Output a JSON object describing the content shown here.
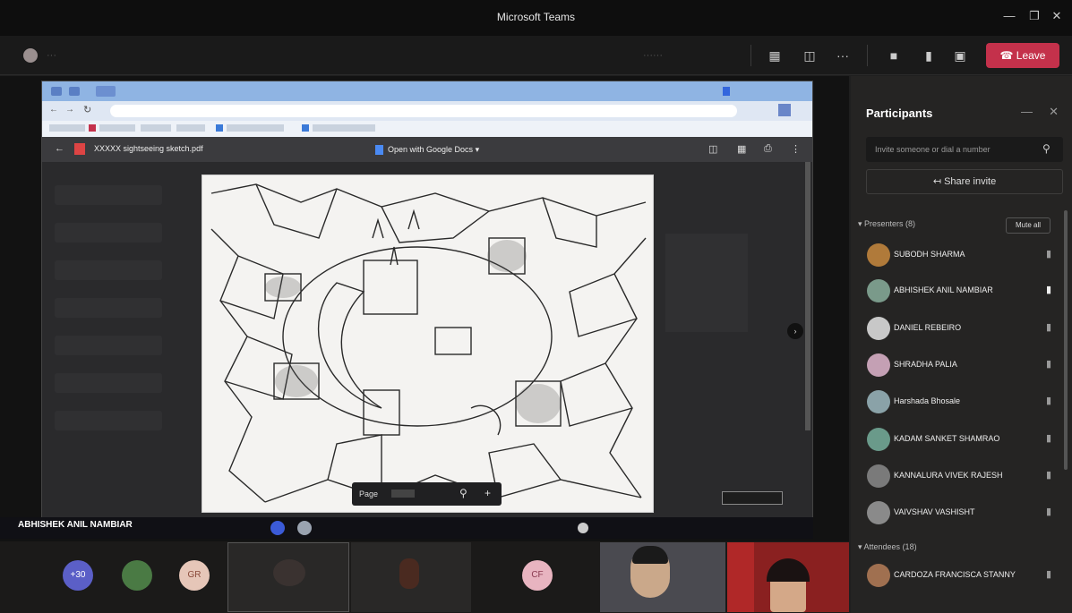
{
  "window": {
    "title": "Microsoft Teams"
  },
  "toolbar": {
    "leave_label": "Leave"
  },
  "browser": {
    "pdf_title": "XXXXX sightseeing sketch.pdf",
    "open_with": "Open with Google Docs",
    "page_label": "Page"
  },
  "taskbar": {
    "presenter_name": "ABHISHEK ANIL NAMBIAR"
  },
  "panel": {
    "title": "Participants",
    "invite_placeholder": "Invite someone or dial a number",
    "share_invite": "Share invite",
    "presenters_label": "Presenters (8)",
    "mute_all": "Mute all",
    "attendees_label": "Attendees (18)",
    "participants": [
      {
        "name": "SUBODH SHARMA",
        "color": "#b07a3a",
        "mic": "muted"
      },
      {
        "name": "ABHISHEK ANIL NAMBIAR",
        "color": "#7a9a8a",
        "mic": "on"
      },
      {
        "name": "DANIEL REBEIRO",
        "color": "#c8c8c8",
        "mic": "muted"
      },
      {
        "name": "SHRADHA PALIA",
        "color": "#c4a0b4",
        "mic": "muted"
      },
      {
        "name": "Harshada Bhosale",
        "color": "#8aa2a8",
        "mic": "muted"
      },
      {
        "name": "KADAM SANKET SHAMRAO",
        "color": "#6a9a8a",
        "mic": "muted"
      },
      {
        "name": "KANNALURA VIVEK RAJESH",
        "color": "#7a7a7a",
        "mic": "muted"
      },
      {
        "name": "VAIVSHAV VASHISHT",
        "color": "#8a8a8a",
        "mic": "muted"
      },
      {
        "name": "CARDOZA FRANCISCA STANNY",
        "color": "#a07050",
        "mic": "muted"
      }
    ]
  },
  "gallery": {
    "avatars": [
      {
        "initials": "+30",
        "color": "#5b5fc7"
      },
      {
        "initials": "",
        "color": "#4a7a44"
      },
      {
        "initials": "GR",
        "color": "#e6c6b8"
      },
      {
        "initials": "CF",
        "color": "#e8b4c0"
      }
    ]
  }
}
